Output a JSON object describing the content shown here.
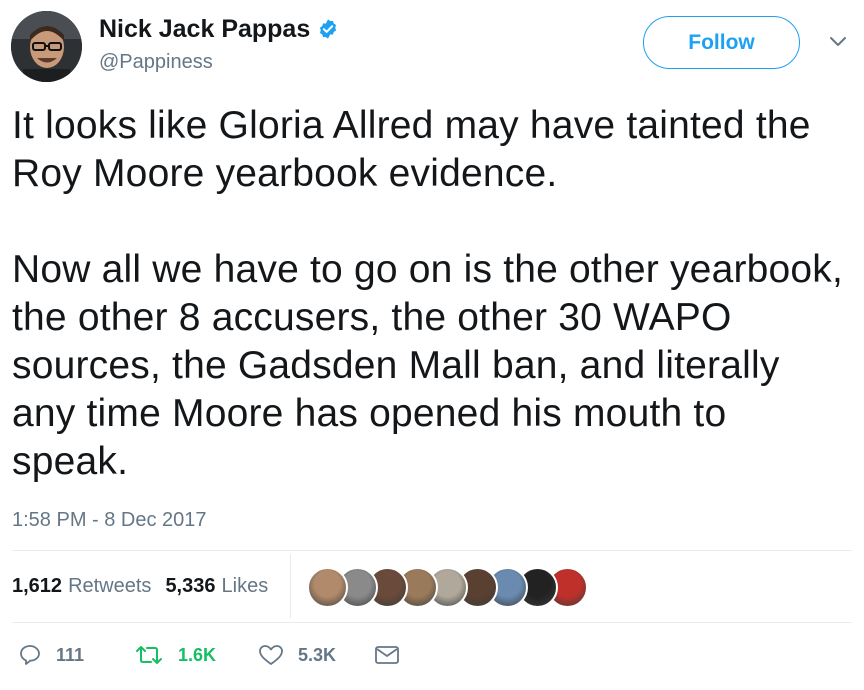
{
  "author": {
    "display_name": "Nick Jack Pappas",
    "handle": "@Pappiness",
    "verified": true,
    "avatar_icon": "user-photo-avatar"
  },
  "header": {
    "follow_label": "Follow",
    "menu_icon": "chevron-down-icon"
  },
  "tweet": {
    "text": "It looks like Gloria Allred may have tainted the Roy Moore yearbook evidence.\n\nNow all we have to go on is the other yearbook, the other 8 accusers, the other 30 WAPO sources, the Gadsden Mall ban, and literally any time Moore has opened his mouth to speak.",
    "timestamp": "1:58 PM - 8 Dec 2017"
  },
  "stats": {
    "retweets_count": "1,612",
    "retweets_label": "Retweets",
    "likes_count": "5,336",
    "likes_label": "Likes",
    "liker_avatars": [
      {
        "name": "liker-avatar-1",
        "color": "#b08a6a"
      },
      {
        "name": "liker-avatar-2",
        "color": "#8a8a8a"
      },
      {
        "name": "liker-avatar-3",
        "color": "#6a4a3a"
      },
      {
        "name": "liker-avatar-4",
        "color": "#9a7a5a"
      },
      {
        "name": "liker-avatar-5",
        "color": "#b0a89a"
      },
      {
        "name": "liker-avatar-6",
        "color": "#5a4030"
      },
      {
        "name": "liker-avatar-7",
        "color": "#6a8ab0"
      },
      {
        "name": "liker-avatar-8",
        "color": "#222222"
      },
      {
        "name": "liker-avatar-9",
        "color": "#c0302a"
      }
    ]
  },
  "actions": {
    "reply_count": "111",
    "retweet_count": "1.6K",
    "like_count": "5.3K",
    "reply_icon": "reply-icon",
    "retweet_icon": "retweet-icon",
    "like_icon": "heart-icon",
    "dm_icon": "envelope-icon"
  },
  "colors": {
    "accent": "#1da1f2",
    "retweet_active": "#17bf63",
    "muted": "#657786",
    "text": "#14171a",
    "divider": "#e6ecf0"
  }
}
